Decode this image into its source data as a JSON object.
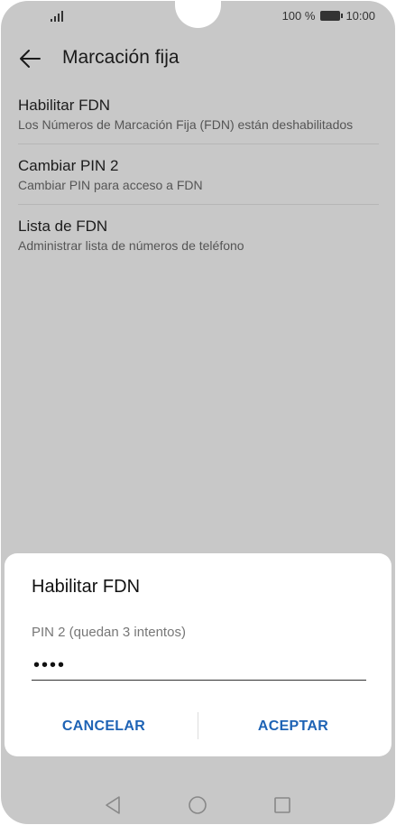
{
  "status_bar": {
    "battery_percent": "100 %",
    "time": "10:00"
  },
  "header": {
    "title": "Marcación fija"
  },
  "settings": [
    {
      "title": "Habilitar FDN",
      "subtitle": "Los Números de Marcación Fija (FDN) están deshabilitados"
    },
    {
      "title": "Cambiar PIN 2",
      "subtitle": "Cambiar PIN para acceso a FDN"
    },
    {
      "title": "Lista de FDN",
      "subtitle": "Administrar lista de números de teléfono"
    }
  ],
  "dialog": {
    "title": "Habilitar FDN",
    "field_label": "PIN 2 (quedan 3 intentos)",
    "field_value": "••••",
    "cancel_label": "CANCELAR",
    "accept_label": "ACEPTAR"
  },
  "icons": {
    "back": "arrow-left-icon",
    "nav_back": "triangle-back-icon",
    "nav_home": "circle-home-icon",
    "nav_recent": "square-recent-icon"
  },
  "colors": {
    "accent": "#1e63b5",
    "scrim_background": "#c8c8c8"
  }
}
